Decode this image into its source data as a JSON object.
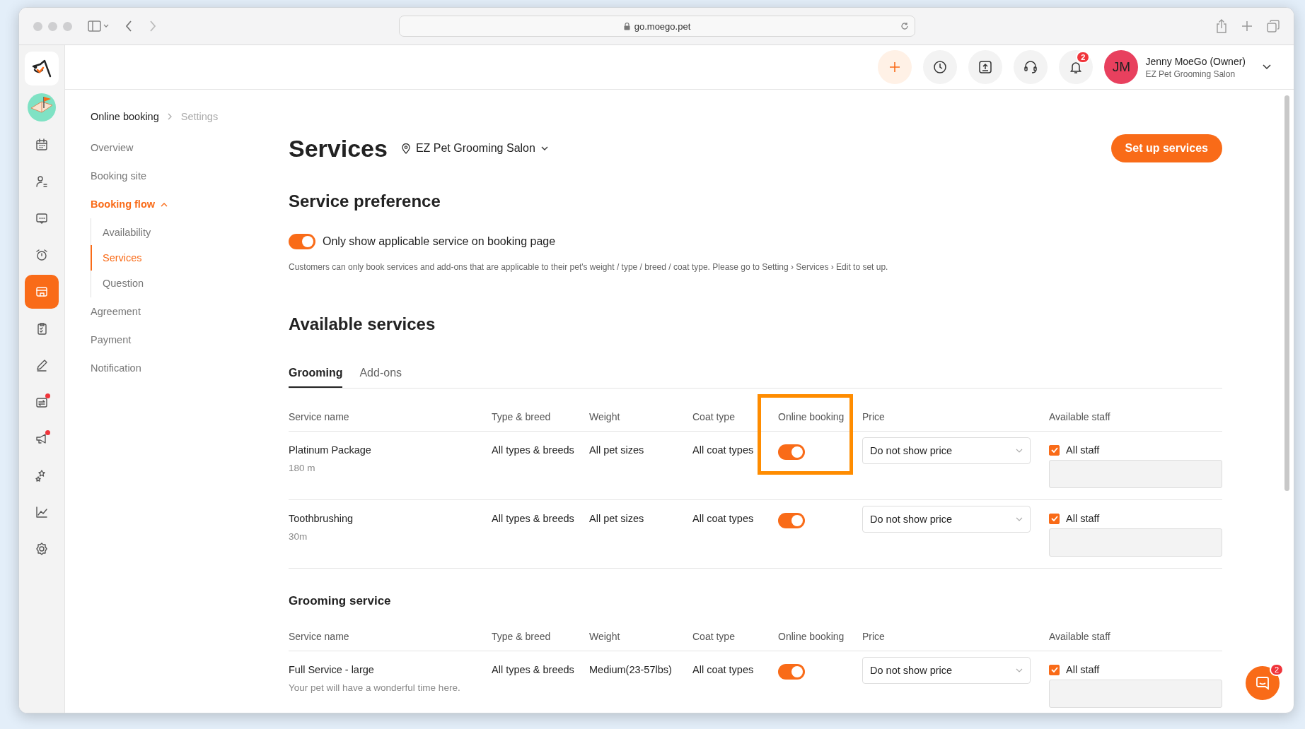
{
  "browser": {
    "url": "go.moego.pet"
  },
  "header": {
    "user_name": "Jenny MoeGo (Owner)",
    "business": "EZ Pet Grooming Salon",
    "avatar_initials": "JM",
    "notification_count": "2"
  },
  "rail": [
    {
      "selected": false,
      "dot": false
    },
    {
      "selected": false,
      "dot": false
    },
    {
      "selected": false,
      "dot": false
    },
    {
      "selected": false,
      "dot": false
    },
    {
      "selected": true,
      "dot": false
    },
    {
      "selected": false,
      "dot": false
    },
    {
      "selected": false,
      "dot": false
    },
    {
      "selected": false,
      "dot": true
    },
    {
      "selected": false,
      "dot": true
    },
    {
      "selected": false,
      "dot": false
    },
    {
      "selected": false,
      "dot": false
    },
    {
      "selected": false,
      "dot": false
    }
  ],
  "breadcrumb": [
    "Online booking",
    "Settings"
  ],
  "nav": [
    {
      "label": "Overview",
      "selected": false
    },
    {
      "label": "Booking site",
      "selected": false
    },
    {
      "label": "Booking flow",
      "selected": true,
      "expanded": true,
      "children": [
        {
          "label": "Availability",
          "selected": false
        },
        {
          "label": "Services",
          "selected": true
        },
        {
          "label": "Question",
          "selected": false
        }
      ]
    },
    {
      "label": "Agreement",
      "selected": false
    },
    {
      "label": "Payment",
      "selected": false
    },
    {
      "label": "Notification",
      "selected": false
    }
  ],
  "page": {
    "title": "Services",
    "location": "EZ Pet Grooming Salon",
    "action": "Set up services"
  },
  "preference": {
    "heading": "Service preference",
    "toggle_label": "Only show applicable service on booking page",
    "on": true,
    "note": "Customers can only book services and add-ons that are applicable to their pet's weight / type / breed / coat type. Please go to Setting › Services › Edit to set up."
  },
  "available": {
    "heading": "Available services",
    "tabs": [
      {
        "label": "Grooming",
        "selected": true
      },
      {
        "label": "Add-ons",
        "selected": false
      }
    ],
    "groups": [
      {
        "columns": [
          "Service name",
          "Type & breed",
          "Weight",
          "Coat type",
          "Online booking",
          "Price",
          "Available staff"
        ],
        "highlight_online_booking": true,
        "rows": [
          {
            "name": "Platinum Package",
            "duration": "180 m",
            "type_breed": "All types & breeds",
            "weight": "All pet sizes",
            "coat": "All coat types",
            "online": true,
            "price": "Do not show price",
            "staff_checked": true,
            "staff_label": "All staff"
          },
          {
            "name": "Toothbrushing",
            "duration": "30m",
            "type_breed": "All types & breeds",
            "weight": "All pet sizes",
            "coat": "All coat types",
            "online": true,
            "price": "Do not show price",
            "staff_checked": true,
            "staff_label": "All staff"
          }
        ]
      },
      {
        "title": "Grooming service",
        "columns": [
          "Service name",
          "Type & breed",
          "Weight",
          "Coat type",
          "Online booking",
          "Price",
          "Available staff"
        ],
        "highlight_online_booking": false,
        "rows": [
          {
            "name": "Full Service - large",
            "duration": "Your pet will have a wonderful time here.",
            "type_breed": "All types & breeds",
            "weight": "Medium(23-57lbs)",
            "coat": "All coat types",
            "online": true,
            "price": "Do not show price",
            "staff_checked": true,
            "staff_label": "All staff"
          }
        ]
      }
    ]
  },
  "chat": {
    "badge": "2"
  }
}
